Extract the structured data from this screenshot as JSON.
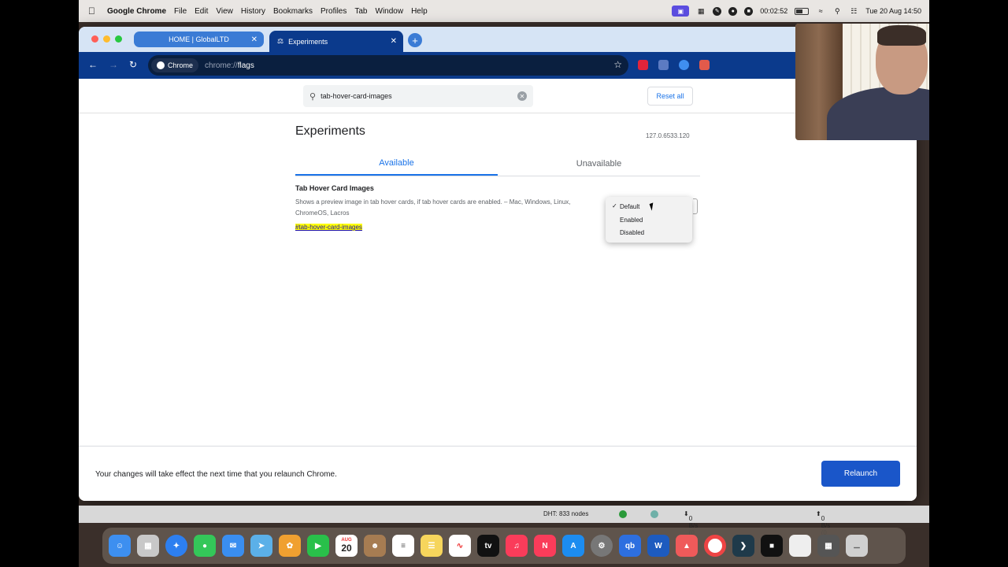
{
  "menubar": {
    "app_name": "Google Chrome",
    "items": [
      "File",
      "Edit",
      "View",
      "History",
      "Bookmarks",
      "Profiles",
      "Tab",
      "Window",
      "Help"
    ],
    "timer": "00:02:52",
    "clock": "Tue 20 Aug  14:50"
  },
  "browser": {
    "tabs": [
      {
        "title": "HOME | GlobalLTD",
        "active": false
      },
      {
        "title": "Experiments",
        "active": true
      }
    ],
    "omnibox": {
      "chip": "Chrome",
      "url_prefix": "chrome://",
      "url_path": "flags"
    }
  },
  "page": {
    "search_value": "tab-hover-card-images",
    "reset_label": "Reset all",
    "title": "Experiments",
    "version": "127.0.6533.120",
    "tabs": [
      "Available",
      "Unavailable"
    ],
    "flag": {
      "name": "Tab Hover Card Images",
      "description": "Shows a preview image in tab hover cards, if tab hover cards are enabled. – Mac, Windows, Linux, ChromeOS, Lacros",
      "link": "#tab-hover-card-images"
    },
    "dropdown": {
      "options": [
        "Default",
        "Enabled",
        "Disabled"
      ],
      "selected": "Default"
    },
    "footer": {
      "message": "Your changes will take effect the next time that you relaunch Chrome.",
      "button": "Relaunch"
    }
  },
  "statusbar": {
    "dht": "DHT: 833 nodes",
    "down": "0 B/s (0 B)",
    "up": "0 B/s (0 B)"
  },
  "dock": {
    "calendar_month": "AUG",
    "calendar_day": "20"
  }
}
